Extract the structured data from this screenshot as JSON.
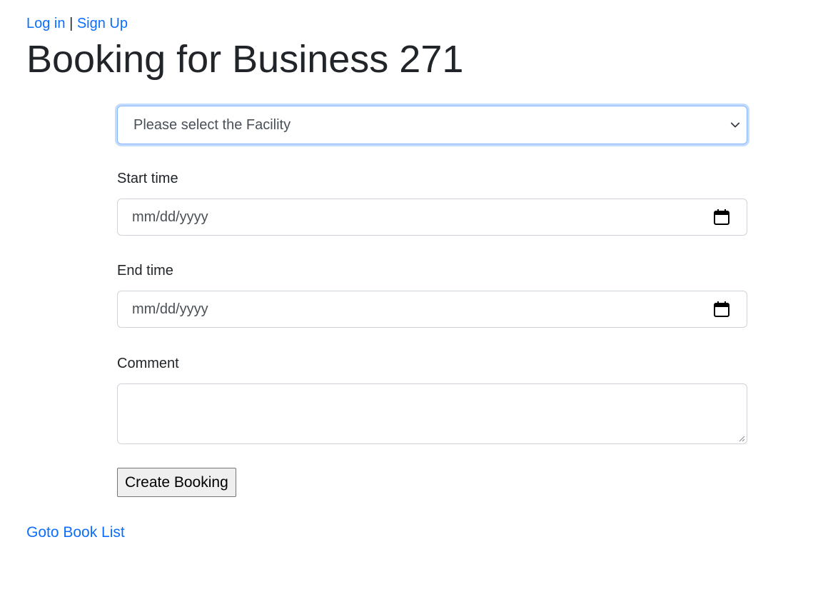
{
  "header": {
    "login_label": "Log in",
    "separator": "|",
    "signup_label": "Sign Up",
    "title": "Booking for Business 271"
  },
  "form": {
    "facility_select": {
      "selected": "Please select the Facility",
      "icon": "chevron-down-icon"
    },
    "start_time": {
      "label": "Start time",
      "placeholder": "mm/dd/yyyy",
      "icon": "calendar-icon"
    },
    "end_time": {
      "label": "End time",
      "placeholder": "mm/dd/yyyy",
      "icon": "calendar-icon"
    },
    "comment": {
      "label": "Comment",
      "value": ""
    },
    "submit_label": "Create Booking"
  },
  "footer": {
    "goto_label": "Goto Book List"
  },
  "colors": {
    "link": "#0d6efd",
    "text": "#212529",
    "focus_border": "#86b7fe",
    "input_border": "#ced4da"
  }
}
